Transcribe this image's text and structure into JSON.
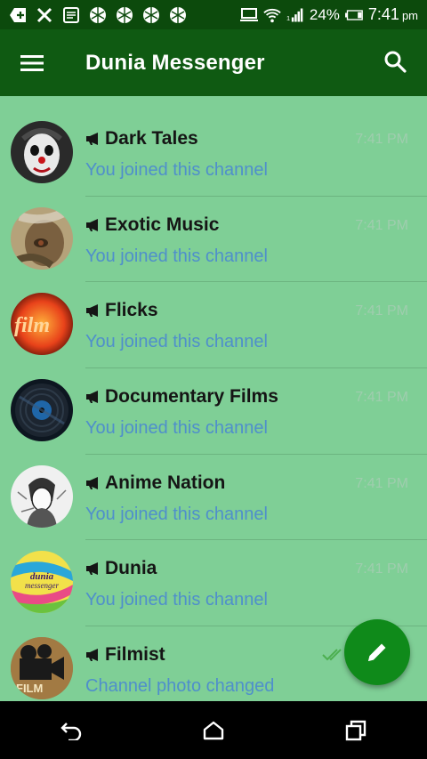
{
  "status_bar": {
    "battery_percent": "24%",
    "time": "7:41",
    "ampm": "pm",
    "icons": [
      "add-box-icon",
      "close-x-icon",
      "news-icon",
      "aperture-icon",
      "aperture-icon",
      "aperture-icon",
      "aperture-icon",
      "cast-icon",
      "wifi-icon",
      "signal-icon",
      "battery-icon"
    ]
  },
  "toolbar": {
    "title": "Dunia Messenger"
  },
  "chats": [
    {
      "title": "Dark Tales",
      "subtitle": "You joined this channel",
      "time": "7:41 PM"
    },
    {
      "title": "Exotic Music",
      "subtitle": "You joined this channel",
      "time": "7:41 PM"
    },
    {
      "title": "Flicks",
      "subtitle": "You joined this channel",
      "time": "7:41 PM"
    },
    {
      "title": "Documentary Films",
      "subtitle": "You joined this channel",
      "time": "7:41 PM"
    },
    {
      "title": "Anime Nation",
      "subtitle": "You joined this channel",
      "time": "7:41 PM"
    },
    {
      "title": "Dunia",
      "subtitle": "You joined this channel",
      "time": "7:41 PM",
      "avatar_text": "dunia messenger"
    },
    {
      "title": "Filmist",
      "subtitle": "Channel photo changed",
      "time": "",
      "avatar_text": "FILM"
    }
  ],
  "colors": {
    "status_bar": "#0c4a0c",
    "toolbar": "#0f5a12",
    "list_background": "#7fcf96",
    "subtitle": "#4f8fcb",
    "fab": "#0f8a1a"
  }
}
